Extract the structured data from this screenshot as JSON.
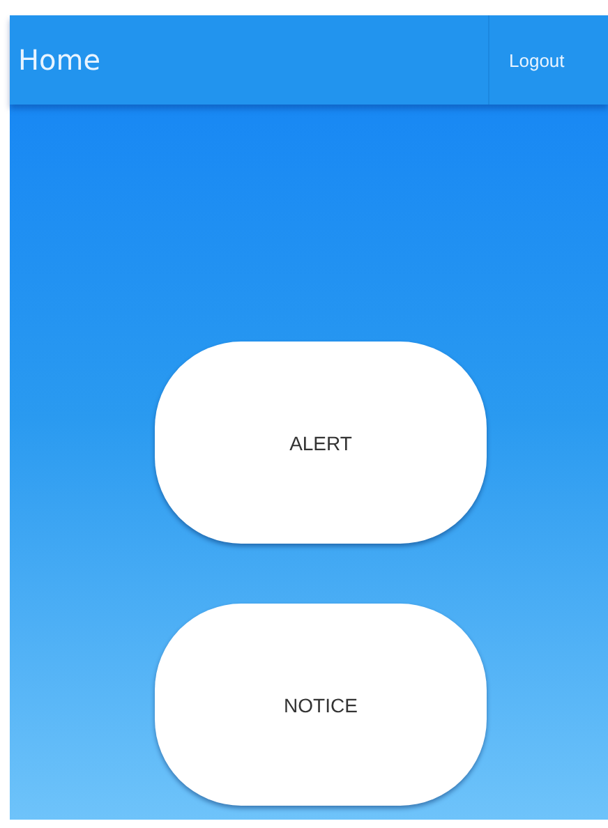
{
  "app_bar": {
    "title": "Home",
    "action": "Logout"
  },
  "buttons": [
    {
      "label": "ALERT"
    },
    {
      "label": "NOTICE"
    }
  ]
}
